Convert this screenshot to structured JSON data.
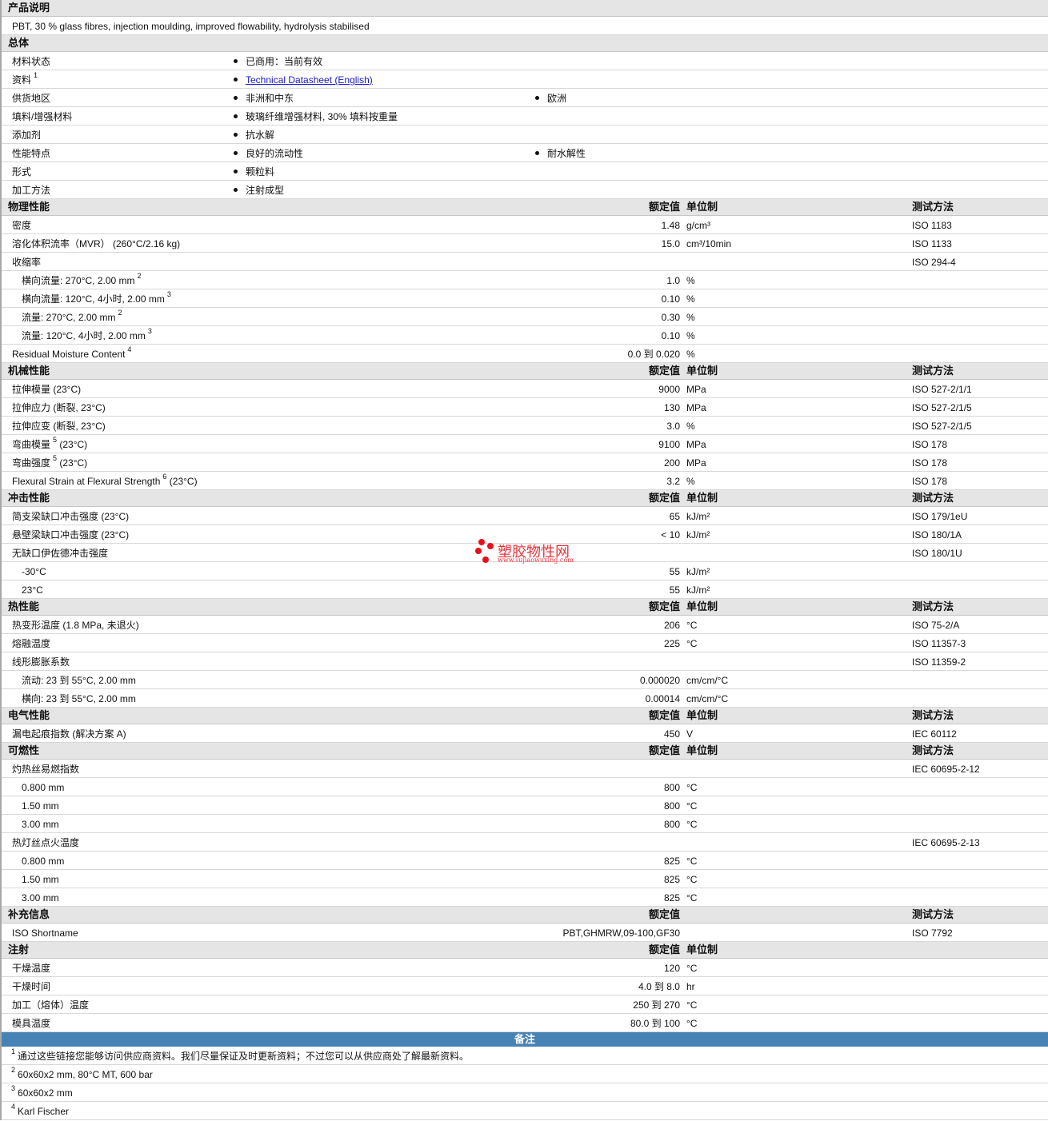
{
  "description": {
    "title": "产品说明",
    "text": "PBT, 30 % glass fibres, injection moulding, improved flowability, hydrolysis stabilised"
  },
  "general": {
    "title": "总体",
    "rows": [
      {
        "label": "材料状态",
        "items": [
          "已商用：当前有效"
        ]
      },
      {
        "label": "资料",
        "sup": "1",
        "items": [
          "Technical Datasheet (English)"
        ],
        "link": true
      },
      {
        "label": "供货地区",
        "items": [
          "非洲和中东",
          "欧洲"
        ]
      },
      {
        "label": "填料/增强材料",
        "items": [
          "玻璃纤维增强材料, 30% 填料按重量"
        ]
      },
      {
        "label": "添加剂",
        "items": [
          "抗水解"
        ]
      },
      {
        "label": "性能特点",
        "items": [
          "良好的流动性",
          "耐水解性"
        ]
      },
      {
        "label": "形式",
        "items": [
          "颗粒料"
        ]
      },
      {
        "label": "加工方法",
        "items": [
          "注射成型"
        ]
      }
    ]
  },
  "columns": {
    "value": "额定值",
    "unit": "单位制",
    "method": "测试方法"
  },
  "sections": [
    {
      "title": "物理性能",
      "hasUnit": true,
      "rows": [
        {
          "label": "密度",
          "value": "1.48",
          "unit": "g/cm³",
          "method": "ISO 1183"
        },
        {
          "label": "溶化体积流率（MVR） (260°C/2.16 kg)",
          "value": "15.0",
          "unit": "cm³/10min",
          "method": "ISO 1133"
        },
        {
          "label": "收缩率",
          "method": "ISO 294-4"
        },
        {
          "label": "横向流量: 270°C, 2.00 mm",
          "sup": "2",
          "value": "1.0",
          "unit": "%",
          "indent": true
        },
        {
          "label": "横向流量: 120°C, 4小时, 2.00 mm",
          "sup": "3",
          "value": "0.10",
          "unit": "%",
          "indent": true
        },
        {
          "label": "流量: 270°C, 2.00 mm",
          "sup": "2",
          "value": "0.30",
          "unit": "%",
          "indent": true
        },
        {
          "label": "流量: 120°C, 4小时, 2.00 mm",
          "sup": "3",
          "value": "0.10",
          "unit": "%",
          "indent": true
        },
        {
          "label": "Residual Moisture Content",
          "sup": "4",
          "value": "0.0 到  0.020",
          "unit": "%"
        }
      ]
    },
    {
      "title": "机械性能",
      "hasUnit": true,
      "rows": [
        {
          "label": "拉伸模量 (23°C)",
          "value": "9000",
          "unit": "MPa",
          "method": "ISO 527-2/1/1"
        },
        {
          "label": "拉伸应力 (断裂, 23°C)",
          "value": "130",
          "unit": "MPa",
          "method": "ISO 527-2/1/5"
        },
        {
          "label": "拉伸应变 (断裂, 23°C)",
          "value": "3.0",
          "unit": "%",
          "method": "ISO 527-2/1/5"
        },
        {
          "label": "弯曲模量",
          "sup": "5",
          "after": "(23°C)",
          "value": "9100",
          "unit": "MPa",
          "method": "ISO 178"
        },
        {
          "label": "弯曲强度",
          "sup": "5",
          "after": "(23°C)",
          "value": "200",
          "unit": "MPa",
          "method": "ISO 178"
        },
        {
          "label": "Flexural Strain at Flexural Strength",
          "sup": "6",
          "after": "(23°C)",
          "value": "3.2",
          "unit": "%",
          "method": "ISO 178"
        }
      ]
    },
    {
      "title": "冲击性能",
      "hasUnit": true,
      "rows": [
        {
          "label": "简支梁缺口冲击强度 (23°C)",
          "value": "65",
          "unit": "kJ/m²",
          "method": "ISO 179/1eU"
        },
        {
          "label": "悬壁梁缺口冲击强度 (23°C)",
          "value": "< 10",
          "unit": "kJ/m²",
          "method": "ISO 180/1A"
        },
        {
          "label": "无缺口伊佐德冲击强度",
          "method": "ISO 180/1U"
        },
        {
          "label": "-30°C",
          "value": "55",
          "unit": "kJ/m²",
          "indent": true
        },
        {
          "label": "23°C",
          "value": "55",
          "unit": "kJ/m²",
          "indent": true
        }
      ]
    },
    {
      "title": "热性能",
      "hasUnit": true,
      "rows": [
        {
          "label": "热变形温度 (1.8 MPa, 未退火)",
          "value": "206",
          "unit": "°C",
          "method": "ISO 75-2/A"
        },
        {
          "label": "熔融温度",
          "value": "225",
          "unit": "°C",
          "method": "ISO 11357-3"
        },
        {
          "label": "线形膨胀系数",
          "method": "ISO 11359-2"
        },
        {
          "label": "流动: 23 到  55°C, 2.00 mm",
          "value": "0.000020",
          "unit": "cm/cm/°C",
          "indent": true
        },
        {
          "label": "横向: 23 到  55°C, 2.00 mm",
          "value": "0.00014",
          "unit": "cm/cm/°C",
          "indent": true
        }
      ]
    },
    {
      "title": "电气性能",
      "hasUnit": true,
      "rows": [
        {
          "label": "漏电起痕指数 (解决方案 A)",
          "value": "450",
          "unit": "V",
          "method": "IEC 60112"
        }
      ]
    },
    {
      "title": "可燃性",
      "hasUnit": true,
      "rows": [
        {
          "label": "灼热丝易燃指数",
          "method": "IEC 60695-2-12"
        },
        {
          "label": "0.800 mm",
          "value": "800",
          "unit": "°C",
          "indent": true
        },
        {
          "label": "1.50 mm",
          "value": "800",
          "unit": "°C",
          "indent": true
        },
        {
          "label": "3.00 mm",
          "value": "800",
          "unit": "°C",
          "indent": true
        },
        {
          "label": "热灯丝点火温度",
          "method": "IEC 60695-2-13"
        },
        {
          "label": "0.800 mm",
          "value": "825",
          "unit": "°C",
          "indent": true
        },
        {
          "label": "1.50 mm",
          "value": "825",
          "unit": "°C",
          "indent": true
        },
        {
          "label": "3.00 mm",
          "value": "825",
          "unit": "°C",
          "indent": true
        }
      ]
    },
    {
      "title": "补充信息",
      "hasUnit": false,
      "rows": [
        {
          "label": "ISO Shortname",
          "value": "PBT,GHMRW,09-100,GF30",
          "method": "ISO 7792"
        }
      ]
    },
    {
      "title": "注射",
      "hasUnit": true,
      "noMethod": true,
      "rows": [
        {
          "label": "干燥温度",
          "value": "120",
          "unit": "°C"
        },
        {
          "label": "干燥时间",
          "value": "4.0 到  8.0",
          "unit": "hr"
        },
        {
          "label": "加工（熔体）温度",
          "value": "250 到  270",
          "unit": "°C"
        },
        {
          "label": "模具温度",
          "value": "80.0 到  100",
          "unit": "°C"
        }
      ]
    }
  ],
  "notes": {
    "title": "备注",
    "items": [
      {
        "sup": "1",
        "text": "通过这些链接您能够访问供应商资料。我们尽量保证及时更新资料；不过您可以从供应商处了解最新资料。"
      },
      {
        "sup": "2",
        "text": "60x60x2 mm, 80°C MT, 600 bar"
      },
      {
        "sup": "3",
        "text": "60x60x2 mm"
      },
      {
        "sup": "4",
        "text": "Karl Fischer"
      }
    ]
  },
  "watermark": {
    "name": "塑胶物性网",
    "url": "www.sujiaowuxing.com"
  }
}
